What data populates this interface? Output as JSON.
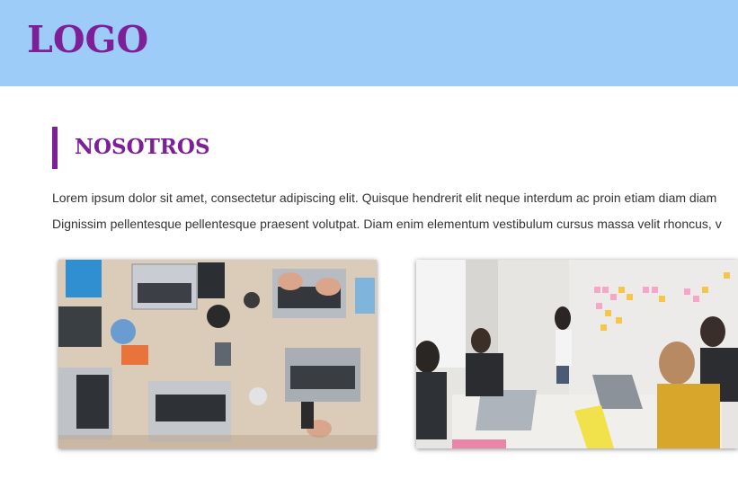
{
  "header": {
    "logo_text": "LOGO",
    "background": "#9dccf8",
    "brand_color": "#7d1f97"
  },
  "section": {
    "title": "NOSOTROS",
    "paragraph_1": "Lorem ipsum dolor sit amet, consectetur adipiscing elit. Quisque hendrerit elit neque interdum ac proin etiam diam diam",
    "paragraph_2": "Dignissim pellentesque pellentesque praesent volutpat. Diam enim elementum vestibulum cursus massa velit rhoncus, v"
  },
  "photos": [
    {
      "icon": "team-laptops-desk-photo"
    },
    {
      "icon": "team-meeting-whiteboard-photo"
    }
  ]
}
